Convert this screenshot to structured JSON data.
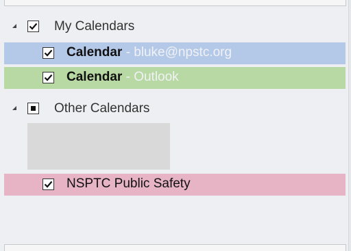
{
  "groups": {
    "my": {
      "label": "My Calendars",
      "state": "checked"
    },
    "other": {
      "label": "Other Calendars",
      "state": "partial"
    }
  },
  "calendars": [
    {
      "name": "Calendar",
      "separator": " - ",
      "account": "bluke@npstc.org",
      "color": "#b4c8e8",
      "checked": true
    },
    {
      "name": "Calendar",
      "separator": " - ",
      "account": "Outlook",
      "color": "#b8d8a4",
      "checked": true
    },
    {
      "name": "NSPTC Public Safety",
      "separator": "",
      "account": "",
      "color": "#e6b4c4",
      "checked": true
    }
  ],
  "colors": {
    "pane": "#eeeff2",
    "placeholder": "#d9d9d9"
  }
}
